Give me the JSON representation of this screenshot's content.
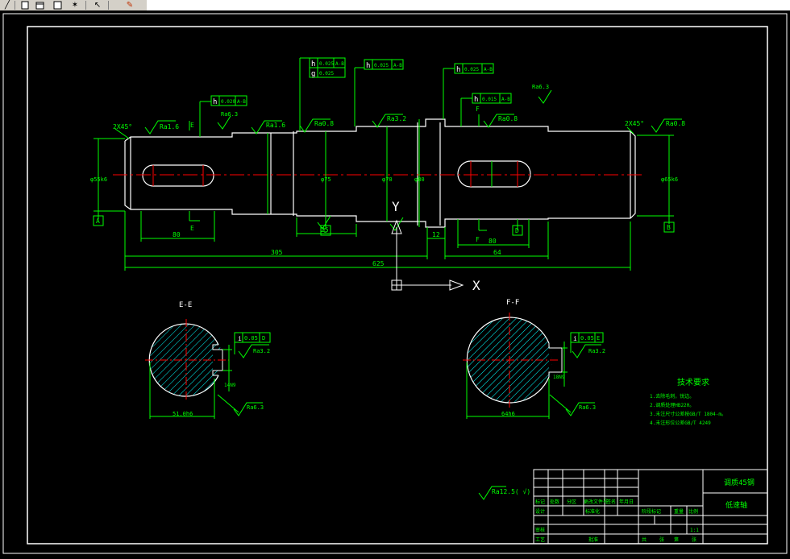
{
  "toolbar": {
    "icons": [
      "slash-tool-icon",
      "new-file-icon",
      "open-file-icon",
      "star-icon",
      "arrow-icon",
      "paint-icon"
    ]
  },
  "colors": {
    "background": "#000000",
    "frame": "#ffffff",
    "geometry": "#ffffff",
    "dimension": "#00ff00",
    "centerline": "#ff0000",
    "hatch": "#00ffff",
    "ucs": "#ffffff"
  },
  "drawing": {
    "shaft_dims": {
      "chamfer_left": "2X45°",
      "chamfer_right": "2X45°",
      "ra_1_6": "Ra1.6",
      "ra_0_8": "Ra0.8",
      "ra_3_2": "Ra3.2",
      "ra_6_3": "Ra6.3",
      "ra_12_5": "Ra12.5",
      "dia_left": "φ55k6",
      "dia_right": "φ65k6",
      "dia_mid": "φ75",
      "dia_gear": "φ80",
      "dia_2": "φ70",
      "len_key1": "80",
      "len_key2": "80",
      "len_seg": "25",
      "len_12": "12",
      "len_total_left": "305",
      "len_total": "625",
      "len_right": "64"
    },
    "tolerance_frames": [
      {
        "sym": "h",
        "val": "0.020",
        "ref": "A-B"
      },
      {
        "sym": "h",
        "val": "0.025",
        "ref": "A-B"
      },
      {
        "sym": "h",
        "val": "0.025",
        "ref": "A-B"
      },
      {
        "sym": "h",
        "val": "0.025",
        "ref": "A-B"
      },
      {
        "sym": "h",
        "val": "0.015",
        "ref": "A-B"
      },
      {
        "sym": "g",
        "val": "0.025",
        "ref": ""
      }
    ],
    "datums": {
      "a": "A",
      "b": "B",
      "c": "C",
      "d": "D"
    },
    "section_labels": {
      "e": "E",
      "f": "F"
    },
    "section_titles": {
      "left": "E-E",
      "right": "F-F"
    },
    "section_dims": {
      "left_width": "51.0h6",
      "right_width": "64h6",
      "left_key": "14N9",
      "right_key": "18N9",
      "left_tol": "0.05",
      "right_tol": "0.05",
      "left_ref": "D",
      "right_ref": "E",
      "ra_left": "Ra3.2",
      "ra_right": "Ra3.2",
      "ra_left_b": "Ra6.3",
      "ra_right_b": "Ra6.3"
    },
    "ucs": {
      "x": "X",
      "y": "Y"
    },
    "general_roughness": "Ra12.5( √)",
    "tech_requirements": {
      "title": "技术要求",
      "lines": [
        "1.去除毛刺，锐边。",
        "2.调质处理HB220。",
        "3.未注尺寸公差按GB/T 1804-m。",
        "4.未注形位公差GB/T 4249"
      ]
    },
    "title_block": {
      "material": "调质45钢",
      "name": "低速轴",
      "scale": "1:1",
      "headers": [
        "标记",
        "处数",
        "分区",
        "更改文件号",
        "签名",
        "年月日"
      ],
      "row2": [
        "设计",
        "",
        "标准化"
      ],
      "row3": [
        "审核"
      ],
      "row4": [
        "工艺",
        "",
        "批准"
      ],
      "stage_labels": [
        "阶段标记",
        "重量",
        "比例"
      ],
      "sheet_labels": [
        "共",
        "张",
        "第",
        "张"
      ]
    }
  }
}
